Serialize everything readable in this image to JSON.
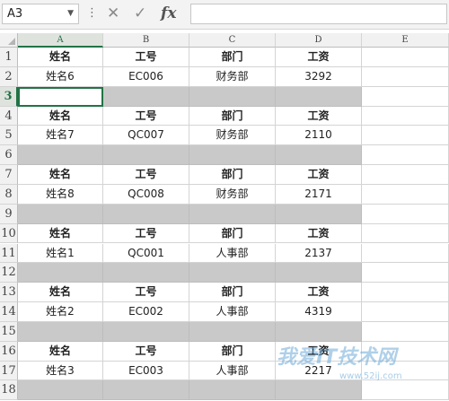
{
  "formula_bar": {
    "name_box": "A3",
    "cancel_icon": "✕",
    "confirm_icon": "✓",
    "fx_label": "fx",
    "formula_value": ""
  },
  "columns": [
    "A",
    "B",
    "C",
    "D",
    "E"
  ],
  "selected_column": "A",
  "active_cell": "A3",
  "rows": [
    {
      "num": "1",
      "type": "header",
      "cells": [
        "姓名",
        "工号",
        "部门",
        "工资"
      ]
    },
    {
      "num": "2",
      "type": "data",
      "cells": [
        "姓名6",
        "EC006",
        "财务部",
        "3292"
      ]
    },
    {
      "num": "3",
      "type": "blank",
      "cells": [
        "",
        "",
        "",
        ""
      ]
    },
    {
      "num": "4",
      "type": "header",
      "cells": [
        "姓名",
        "工号",
        "部门",
        "工资"
      ]
    },
    {
      "num": "5",
      "type": "data",
      "cells": [
        "姓名7",
        "QC007",
        "财务部",
        "2110"
      ]
    },
    {
      "num": "6",
      "type": "blank",
      "cells": [
        "",
        "",
        "",
        ""
      ]
    },
    {
      "num": "7",
      "type": "header",
      "cells": [
        "姓名",
        "工号",
        "部门",
        "工资"
      ]
    },
    {
      "num": "8",
      "type": "data",
      "cells": [
        "姓名8",
        "QC008",
        "财务部",
        "2171"
      ]
    },
    {
      "num": "9",
      "type": "blank",
      "cells": [
        "",
        "",
        "",
        ""
      ]
    },
    {
      "num": "10",
      "type": "header",
      "cells": [
        "姓名",
        "工号",
        "部门",
        "工资"
      ]
    },
    {
      "num": "11",
      "type": "data",
      "cells": [
        "姓名1",
        "QC001",
        "人事部",
        "2137"
      ]
    },
    {
      "num": "12",
      "type": "blank",
      "cells": [
        "",
        "",
        "",
        ""
      ]
    },
    {
      "num": "13",
      "type": "header",
      "cells": [
        "姓名",
        "工号",
        "部门",
        "工资"
      ]
    },
    {
      "num": "14",
      "type": "data",
      "cells": [
        "姓名2",
        "EC002",
        "人事部",
        "4319"
      ]
    },
    {
      "num": "15",
      "type": "blank",
      "cells": [
        "",
        "",
        "",
        ""
      ]
    },
    {
      "num": "16",
      "type": "header",
      "cells": [
        "姓名",
        "工号",
        "部门",
        "工资"
      ]
    },
    {
      "num": "17",
      "type": "data",
      "cells": [
        "姓名3",
        "EC003",
        "人事部",
        "2217"
      ]
    },
    {
      "num": "18",
      "type": "blank",
      "cells": [
        "",
        "",
        "",
        ""
      ]
    }
  ],
  "watermark": {
    "main": "我爱IT技术网",
    "sub": "www.52ij.com"
  },
  "colors": {
    "accent": "#217346",
    "blank_row": "#c9c9c9",
    "grid": "#d4d4d4"
  }
}
